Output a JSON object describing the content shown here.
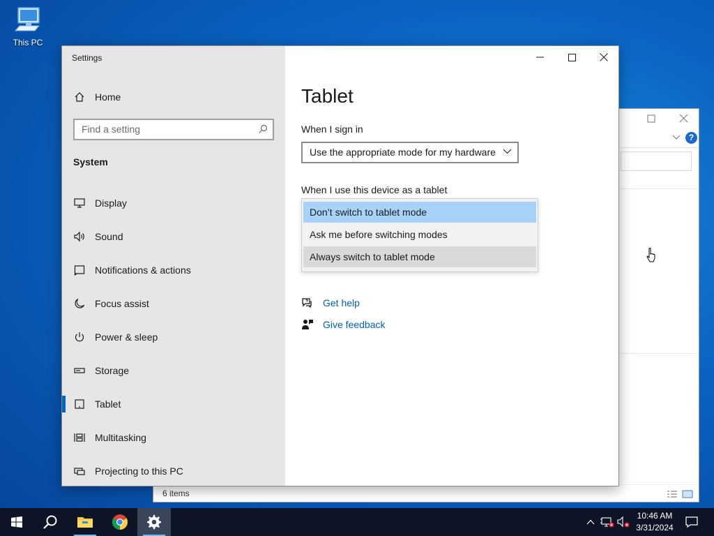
{
  "desktop": {
    "icon_label": "This PC"
  },
  "explorer": {
    "status": "6 items",
    "help_glyph": "?"
  },
  "settings": {
    "window_title": "Settings",
    "sidebar": {
      "home": "Home",
      "search_placeholder": "Find a setting",
      "section": "System",
      "items": [
        {
          "label": "Display",
          "icon": "monitor-icon"
        },
        {
          "label": "Sound",
          "icon": "speaker-icon"
        },
        {
          "label": "Notifications & actions",
          "icon": "notifications-icon"
        },
        {
          "label": "Focus assist",
          "icon": "moon-icon"
        },
        {
          "label": "Power & sleep",
          "icon": "power-icon"
        },
        {
          "label": "Storage",
          "icon": "storage-icon"
        },
        {
          "label": "Tablet",
          "icon": "tablet-icon",
          "active": true
        },
        {
          "label": "Multitasking",
          "icon": "multitasking-icon"
        },
        {
          "label": "Projecting to this PC",
          "icon": "projector-icon"
        }
      ]
    },
    "page": {
      "title": "Tablet",
      "sign_in_label": "When I sign in",
      "sign_in_value": "Use the appropriate mode for my hardware",
      "tablet_label": "When I use this device as a tablet",
      "options": [
        "Don’t switch to tablet mode",
        "Ask me before switching modes",
        "Always switch to tablet mode"
      ],
      "selected_option": "Don’t switch to tablet mode",
      "get_help": "Get help",
      "give_feedback": "Give feedback"
    }
  },
  "taskbar": {
    "apps": [
      "windows-start",
      "search",
      "file-explorer",
      "chrome",
      "settings"
    ],
    "time": "10:46 AM",
    "date": "3/31/2024"
  },
  "colors": {
    "accent": "#0067c0",
    "link": "#0063b1",
    "selection": "#a8d3f9",
    "sidebar": "#e6e6e6",
    "taskbar": "#0c1425"
  }
}
